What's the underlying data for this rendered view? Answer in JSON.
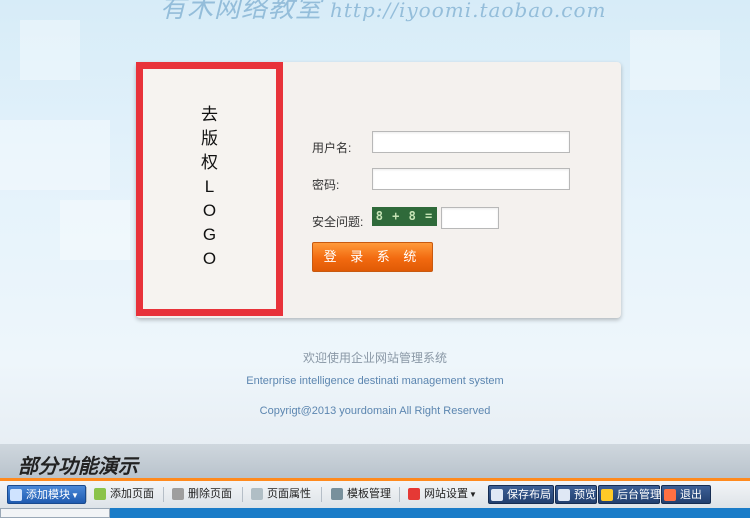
{
  "watermark": {
    "cn": "有木网络教室",
    "url": "http://iyoomi.taobao.com"
  },
  "logo": {
    "chars": [
      "去",
      "版",
      "权",
      "L",
      "O",
      "G",
      "O"
    ]
  },
  "form": {
    "username_label": "用户名:",
    "password_label": "密码:",
    "security_label": "安全问题:",
    "captcha_text": "8 + 8 =",
    "login_button": "登 录 系 统"
  },
  "footer": {
    "welcome_cn": "欢迎使用企业网站管理系统",
    "welcome_en": "Enterprise intelligence destinati management system",
    "copyright": "Copyrigt@2013 yourdomain All Right Reserved"
  },
  "demo": {
    "title": "部分功能演示"
  },
  "toolbar": {
    "add_module": "添加模块",
    "add_page": "添加页面",
    "delete_page": "删除页面",
    "page_props": "页面属性",
    "template_mgmt": "模板管理",
    "site_settings": "网站设置",
    "save_layout": "保存布局",
    "preview": "预览",
    "admin": "后台管理",
    "exit": "退出"
  },
  "colors": {
    "accent_orange": "#f26a10",
    "logo_border": "#e8323a",
    "toolbar_primary": "#1f5bb0"
  }
}
